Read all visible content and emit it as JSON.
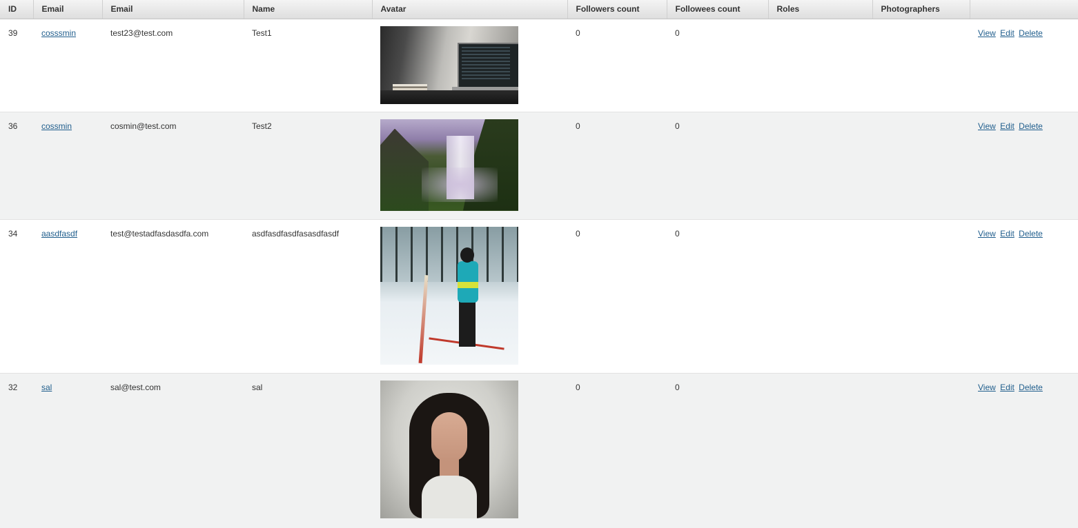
{
  "columns": [
    "ID",
    "Email",
    "Email",
    "Name",
    "Avatar",
    "Followers count",
    "Followees count",
    "Roles",
    "Photographers",
    ""
  ],
  "actions": {
    "view": "View",
    "edit": "Edit",
    "delete": "Delete"
  },
  "rows": [
    {
      "id": "39",
      "username": "cosssmin",
      "email": "test23@test.com",
      "name": "Test1",
      "avatar": "laptop-desk-photo",
      "followers": "0",
      "followees": "0",
      "roles": "",
      "photographers": ""
    },
    {
      "id": "36",
      "username": "cossmin",
      "email": "cosmin@test.com",
      "name": "Test2",
      "avatar": "waterfall-photo",
      "followers": "0",
      "followees": "0",
      "roles": "",
      "photographers": ""
    },
    {
      "id": "34",
      "username": "aasdfasdf",
      "email": "test@testadfasdasdfa.com",
      "name": "asdfasdfasdfasasdfasdf",
      "avatar": "skier-photo",
      "followers": "0",
      "followees": "0",
      "roles": "",
      "photographers": ""
    },
    {
      "id": "32",
      "username": "sal",
      "email": "sal@test.com",
      "name": "sal",
      "avatar": "portrait-photo",
      "followers": "0",
      "followees": "0",
      "roles": "",
      "photographers": ""
    }
  ],
  "colors": {
    "link": "#1f5d8c",
    "row_alt": "#f1f2f2",
    "header_top": "#f4f4f4",
    "header_bottom": "#dedede"
  }
}
